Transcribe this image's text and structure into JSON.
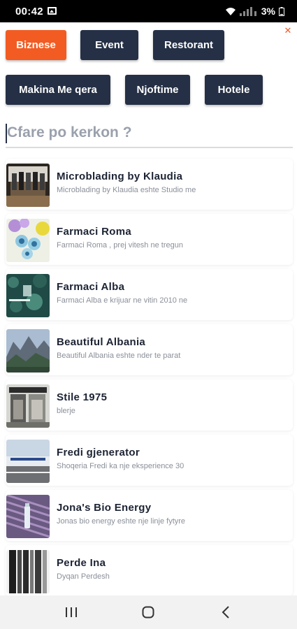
{
  "status_bar": {
    "time": "00:42",
    "battery": "3%"
  },
  "filters": [
    {
      "label": "Biznese",
      "active": true
    },
    {
      "label": "Event",
      "active": false
    },
    {
      "label": "Restorant",
      "active": false
    },
    {
      "label": "Makina Me qera",
      "active": false
    },
    {
      "label": "Njoftime",
      "active": false
    },
    {
      "label": "Hotele",
      "active": false
    }
  ],
  "search": {
    "placeholder": "Cfare po kerkon ?",
    "value": ""
  },
  "listings": [
    {
      "title": "Microblading by Klaudia",
      "subtitle": "Microblading by Klaudia eshte Studio me"
    },
    {
      "title": "Farmaci Roma",
      "subtitle": "Farmaci Roma , prej vitesh ne tregun"
    },
    {
      "title": "Farmaci Alba",
      "subtitle": "Farmaci Alba e krijuar ne vitin 2010 ne"
    },
    {
      "title": "Beautiful Albania",
      "subtitle": "Beautiful Albania eshte nder te parat"
    },
    {
      "title": "Stile 1975",
      "subtitle": "blerje"
    },
    {
      "title": "Fredi gjenerator",
      "subtitle": "Shoqeria Fredi ka nje eksperience 30"
    },
    {
      "title": "Jona's Bio Energy",
      "subtitle": "Jonas bio energy eshte nje linje fytyre"
    },
    {
      "title": "Perde Ina",
      "subtitle": "Dyqan Perdesh"
    }
  ],
  "colors": {
    "accent": "#f25c22",
    "chip": "#253046"
  }
}
